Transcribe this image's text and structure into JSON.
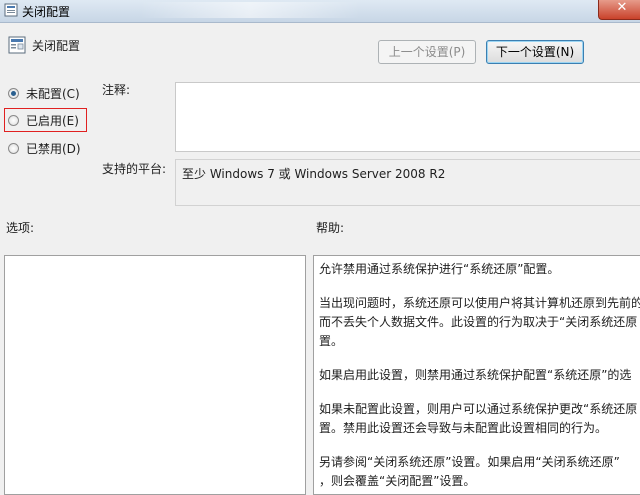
{
  "window": {
    "title": "关闭配置",
    "close_glyph": "✕"
  },
  "header": {
    "title": "关闭配置"
  },
  "nav": {
    "prev_label": "上一个设置(P)",
    "next_label": "下一个设置(N)"
  },
  "state": {
    "options": [
      {
        "label": "未配置(C)",
        "checked": true
      },
      {
        "label": "已启用(E)",
        "checked": false
      },
      {
        "label": "已禁用(D)",
        "checked": false
      }
    ]
  },
  "comment": {
    "label": "注释:",
    "value": ""
  },
  "platform": {
    "label": "支持的平台:",
    "value": "至少 Windows 7 或 Windows Server 2008 R2"
  },
  "options_panel": {
    "label": "选项:"
  },
  "help_panel": {
    "label": "帮助:",
    "lines": [
      "允许禁用通过系统保护进行“系统还原”配置。",
      "当出现问题时，系统还原可以使用户将其计算机还原到先前的",
      "而不丢失个人数据文件。此设置的行为取决于“关闭系统还原",
      "置。",
      "如果启用此设置，则禁用通过系统保护配置“系统还原”的选",
      "如果未配置此设置，则用户可以通过系统保护更改“系统还原",
      "置。禁用此设置还会导致与未配置此设置相同的行为。",
      "另请参阅“关闭系统还原”设置。如果启用“关闭系统还原”",
      "，则会覆盖“关闭配置”设置。"
    ]
  },
  "colors": {
    "highlight": "#e02020",
    "accent": "#3c7fb1"
  }
}
